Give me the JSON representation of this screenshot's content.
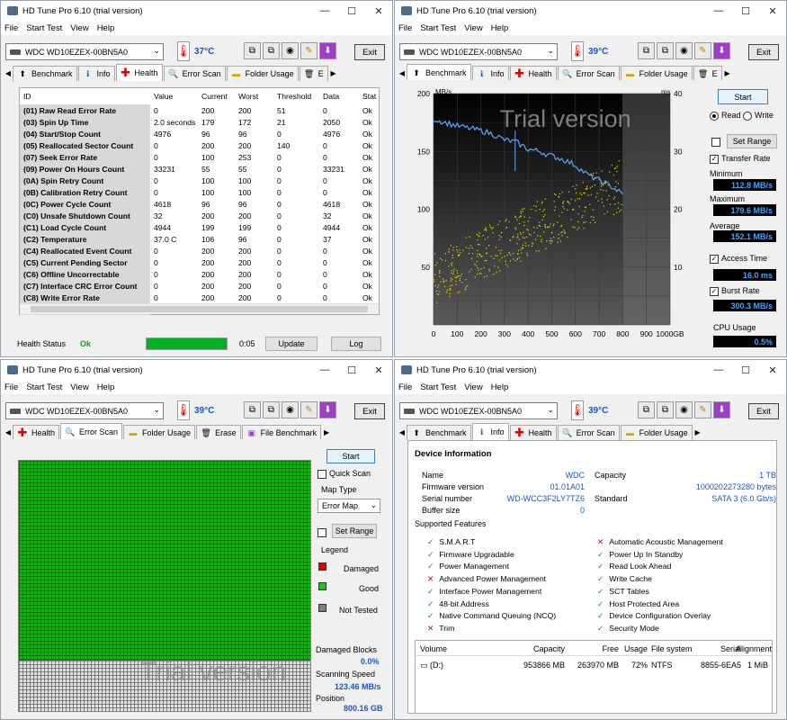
{
  "app_title": "HD Tune Pro 6.10 (trial version)",
  "menu": [
    "File",
    "Start Test",
    "View",
    "Help"
  ],
  "drive": "WDC WD10EZEX-00BN5A0",
  "exit_label": "Exit",
  "health": {
    "temp": "37°C",
    "tabs": [
      "Benchmark",
      "Info",
      "Health",
      "Error Scan",
      "Folder Usage",
      "E"
    ],
    "columns": [
      "ID",
      "Value",
      "Current",
      "Worst",
      "Threshold",
      "Data",
      "Stat"
    ],
    "rows": [
      [
        "(01) Raw Read Error Rate",
        "0",
        "200",
        "200",
        "51",
        "0",
        "Ok"
      ],
      [
        "(03) Spin Up Time",
        "2.0 seconds",
        "179",
        "172",
        "21",
        "2050",
        "Ok"
      ],
      [
        "(04) Start/Stop Count",
        "4976",
        "96",
        "96",
        "0",
        "4976",
        "Ok"
      ],
      [
        "(05) Reallocated Sector Count",
        "0",
        "200",
        "200",
        "140",
        "0",
        "Ok"
      ],
      [
        "(07) Seek Error Rate",
        "0",
        "100",
        "253",
        "0",
        "0",
        "Ok"
      ],
      [
        "(09) Power On Hours Count",
        "33231",
        "55",
        "55",
        "0",
        "33231",
        "Ok"
      ],
      [
        "(0A) Spin Retry Count",
        "0",
        "100",
        "100",
        "0",
        "0",
        "Ok"
      ],
      [
        "(0B) Calibration Retry Count",
        "0",
        "100",
        "100",
        "0",
        "0",
        "Ok"
      ],
      [
        "(0C) Power Cycle Count",
        "4618",
        "96",
        "96",
        "0",
        "4618",
        "Ok"
      ],
      [
        "(C0) Unsafe Shutdown Count",
        "32",
        "200",
        "200",
        "0",
        "32",
        "Ok"
      ],
      [
        "(C1) Load Cycle Count",
        "4944",
        "199",
        "199",
        "0",
        "4944",
        "Ok"
      ],
      [
        "(C2) Temperature",
        "37.0 C",
        "106",
        "96",
        "0",
        "37",
        "Ok"
      ],
      [
        "(C4) Reallocated Event Count",
        "0",
        "200",
        "200",
        "0",
        "0",
        "Ok"
      ],
      [
        "(C5) Current Pending Sector",
        "0",
        "200",
        "200",
        "0",
        "0",
        "Ok"
      ],
      [
        "(C6) Offline Uncorrectable",
        "0",
        "200",
        "200",
        "0",
        "0",
        "Ok"
      ],
      [
        "(C7) Interface CRC Error Count",
        "0",
        "200",
        "200",
        "0",
        "0",
        "Ok"
      ],
      [
        "(C8) Write Error Rate",
        "0",
        "200",
        "200",
        "0",
        "0",
        "Ok"
      ]
    ],
    "status_label": "Health Status",
    "status_value": "Ok",
    "progress": 1.0,
    "time": "0:05",
    "update_label": "Update",
    "log_label": "Log"
  },
  "benchmark": {
    "temp": "39°C",
    "tabs": [
      "Benchmark",
      "Info",
      "Health",
      "Error Scan",
      "Folder Usage",
      "E"
    ],
    "watermark": "Trial version",
    "start_label": "Start",
    "read_label": "Read",
    "write_label": "Write",
    "set_range_label": "Set Range",
    "transfer_rate_label": "Transfer Rate",
    "minimum_label": "Minimum",
    "minimum_value": "112.8 MB/s",
    "maximum_label": "Maximum",
    "maximum_value": "179.6 MB/s",
    "average_label": "Average",
    "average_value": "152.1 MB/s",
    "access_time_label": "Access Time",
    "access_time_value": "16.0 ms",
    "burst_rate_label": "Burst Rate",
    "burst_rate_value": "300.3 MB/s",
    "cpu_label": "CPU Usage",
    "cpu_value": "0.5%",
    "chart_data": {
      "type": "line",
      "y_unit": "MB/s",
      "y2_unit": "ms",
      "ylim": [
        0,
        200
      ],
      "y2lim": [
        0,
        40
      ],
      "xlim": [
        0,
        1000
      ],
      "y_ticks": [
        "200",
        "150",
        "100",
        "50"
      ],
      "y2_ticks": [
        "40",
        "30",
        "20",
        "10"
      ],
      "x_ticks": [
        "0",
        "100",
        "200",
        "300",
        "400",
        "500",
        "600",
        "700",
        "800",
        "900",
        "1000GB"
      ],
      "series": [
        {
          "x": [
            0,
            50,
            100,
            150,
            200,
            250,
            300,
            350,
            400,
            450,
            500,
            550,
            600,
            650,
            700,
            750,
            800
          ],
          "values": [
            178,
            175,
            172,
            170,
            168,
            165,
            160,
            158,
            152,
            150,
            146,
            143,
            138,
            130,
            125,
            120,
            113
          ]
        }
      ],
      "access_range_ms": [
        4,
        26
      ]
    }
  },
  "errorscan": {
    "temp": "39°C",
    "tabs": [
      "Health",
      "Error Scan",
      "Folder Usage",
      "Erase",
      "File Benchmark"
    ],
    "watermark": "Trial version",
    "start_label": "Start",
    "quick_scan_label": "Quick Scan",
    "map_type_label": "Map Type",
    "map_type_value": "Error Map",
    "set_range_label": "Set Range",
    "legend_label": "Legend",
    "legend": [
      "Damaged",
      "Good",
      "Not Tested"
    ],
    "legend_colors": [
      "#e00000",
      "#20c020",
      "#808080"
    ],
    "damaged_blocks_label": "Damaged Blocks",
    "damaged_blocks_value": "0.0%",
    "scanning_speed_label": "Scanning Speed",
    "scanning_speed_value": "123.46 MB/s",
    "position_label": "Position",
    "position_value": "800.16 GB",
    "scan_progress": 0.8
  },
  "info": {
    "temp": "39°C",
    "tabs": [
      "Benchmark",
      "Info",
      "Health",
      "Error Scan",
      "Folder Usage"
    ],
    "section_title": "Device Information",
    "left_fields": [
      [
        "Name",
        "WDC"
      ],
      [
        "Firmware version",
        "01.01A01"
      ],
      [
        "Serial number",
        "WD-WCC3F2LY7TZ6"
      ],
      [
        "Buffer size",
        "0"
      ]
    ],
    "right_fields": [
      [
        "Capacity",
        "1 TB"
      ],
      [
        "",
        "1000202273280 bytes"
      ],
      [
        "Standard",
        "SATA 3 (6.0 Gb/s)"
      ]
    ],
    "supported_label": "Supported Features",
    "features_left": [
      [
        "S.M.A.R.T",
        true
      ],
      [
        "Firmware Upgradable",
        true
      ],
      [
        "Power Management",
        true
      ],
      [
        "Advanced Power Management",
        false
      ],
      [
        "Interface Power Management",
        true
      ],
      [
        "48-bit Address",
        true
      ],
      [
        "Native Command Queuing (NCQ)",
        true
      ],
      [
        "Trim",
        false
      ]
    ],
    "features_right": [
      [
        "Automatic Acoustic Management",
        false
      ],
      [
        "Power Up In Standby",
        true
      ],
      [
        "Read Look Ahead",
        true
      ],
      [
        "Write Cache",
        true
      ],
      [
        "SCT Tables",
        true
      ],
      [
        "Host Protected Area",
        true
      ],
      [
        "Device Configuration Overlay",
        true
      ],
      [
        "Security Mode",
        true
      ]
    ],
    "volume_columns": [
      "Volume",
      "Capacity",
      "Free",
      "Usage",
      "File system",
      "Serial",
      "Alignment"
    ],
    "volume_row": [
      "(D:)",
      "953866 MB",
      "263970 MB",
      "72%",
      "NTFS",
      "8855-6EA5",
      "1 MiB"
    ]
  }
}
